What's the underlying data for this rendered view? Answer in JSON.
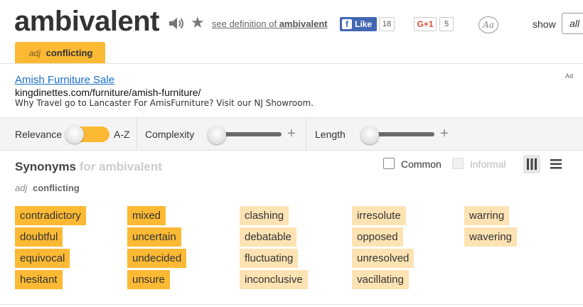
{
  "entry": {
    "word": "ambivalent",
    "see_definition_prefix": "see definition of ",
    "see_definition_word": "ambivalent",
    "facebook": {
      "label": "Like",
      "count": "18"
    },
    "gplus": {
      "label": "G+1",
      "count": "5"
    },
    "font_toggle": "Aa",
    "show_label": "show",
    "show_value": "all"
  },
  "pos_tab": {
    "pos": "adj",
    "sense": "conflicting"
  },
  "ad": {
    "title": "Amish Furniture Sale",
    "url": "kingdinettes.com/furniture/amish-furniture/",
    "description": "Why Travel go to Lancaster For AmisFurniture? Visit our NJ Showroom.",
    "badge": "Ad"
  },
  "filters": {
    "relevance_label": "Relevance",
    "az_label": "A-Z",
    "complexity_label": "Complexity",
    "length_label": "Length",
    "plus": "+"
  },
  "synonyms": {
    "title": "Synonyms",
    "title_suffix": "for ambivalent",
    "common_label": "Common",
    "informal_label": "Informal",
    "sense_pos": "adj",
    "sense_word": "conflicting",
    "columns": [
      [
        {
          "word": "contradictory",
          "relevance": "strong"
        },
        {
          "word": "doubtful",
          "relevance": "strong"
        },
        {
          "word": "equivocal",
          "relevance": "strong"
        },
        {
          "word": "hesitant",
          "relevance": "strong"
        }
      ],
      [
        {
          "word": "mixed",
          "relevance": "strong"
        },
        {
          "word": "uncertain",
          "relevance": "strong"
        },
        {
          "word": "undecided",
          "relevance": "strong"
        },
        {
          "word": "unsure",
          "relevance": "strong"
        }
      ],
      [
        {
          "word": "clashing",
          "relevance": "medium"
        },
        {
          "word": "debatable",
          "relevance": "medium"
        },
        {
          "word": "fluctuating",
          "relevance": "medium"
        },
        {
          "word": "inconclusive",
          "relevance": "medium"
        }
      ],
      [
        {
          "word": "irresolute",
          "relevance": "medium"
        },
        {
          "word": "opposed",
          "relevance": "medium"
        },
        {
          "word": "unresolved",
          "relevance": "medium"
        },
        {
          "word": "vacillating",
          "relevance": "medium"
        }
      ],
      [
        {
          "word": "warring",
          "relevance": "medium"
        },
        {
          "word": "wavering",
          "relevance": "medium"
        }
      ]
    ]
  },
  "colors": {
    "strong": "#fbb934",
    "medium": "#fde3b3",
    "link": "#1a6fc9",
    "facebook": "#4267b2",
    "gplus": "#dd4b39"
  },
  "icons": {
    "speaker": "speaker-icon",
    "star": "star-icon",
    "column_view": "columns-view-icon",
    "list_view": "list-view-icon"
  }
}
